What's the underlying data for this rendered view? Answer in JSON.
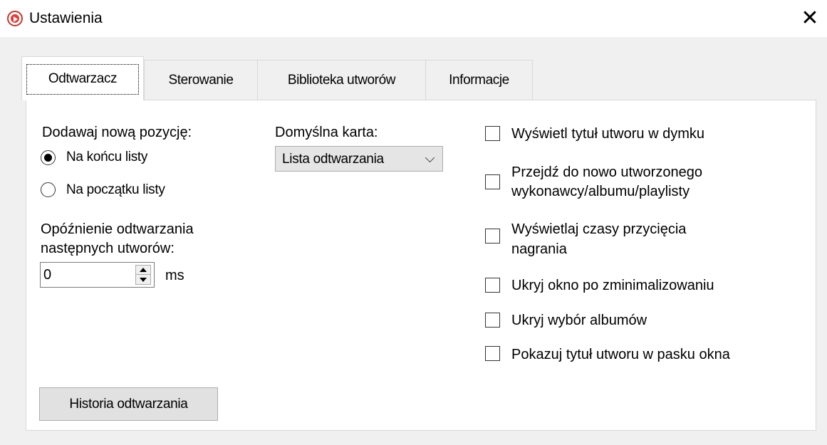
{
  "window": {
    "title": "Ustawienia",
    "close_glyph": "✕"
  },
  "tabs": [
    {
      "label": "Odtwarzacz",
      "active": true
    },
    {
      "label": "Sterowanie",
      "active": false
    },
    {
      "label": "Biblioteka utworów",
      "active": false
    },
    {
      "label": "Informacje",
      "active": false
    }
  ],
  "player": {
    "add_position": {
      "label": "Dodawaj nową pozycję:",
      "options": [
        {
          "label": "Na końcu listy",
          "checked": true
        },
        {
          "label": "Na początku listy",
          "checked": false
        }
      ]
    },
    "delay": {
      "label_line1": "Opóźnienie odtwarzania",
      "label_line2": "następnych utworów:",
      "value": "0",
      "unit": "ms"
    },
    "default_tab": {
      "label": "Domyślna karta:",
      "selected": "Lista odtwarzania"
    },
    "options": [
      {
        "line1": "Wyświetl tytuł utworu w dymku",
        "line2": "",
        "checked": false
      },
      {
        "line1": "Przejdź do nowo utworzonego",
        "line2": "wykonawcy/albumu/playlisty",
        "checked": false
      },
      {
        "line1": "Wyświetlaj czasy przycięcia",
        "line2": "nagrania",
        "checked": false
      },
      {
        "line1": "Ukryj okno po zminimalizowaniu",
        "line2": "",
        "checked": false
      },
      {
        "line1": "Ukryj wybór albumów",
        "line2": "",
        "checked": false
      },
      {
        "line1": "Pokazuj tytuł utworu w pasku okna",
        "line2": "",
        "checked": false
      }
    ],
    "history_button": "Historia odtwarzania"
  },
  "icons": {
    "app": "play-circle-icon",
    "close": "close-icon",
    "dropdown": "chevron-down-icon",
    "spin_up": "arrow-up-icon",
    "spin_down": "arrow-down-icon"
  },
  "colors": {
    "app_icon": "#e53935",
    "window_bg": "#f0f0f0",
    "panel_bg": "#ffffff"
  }
}
